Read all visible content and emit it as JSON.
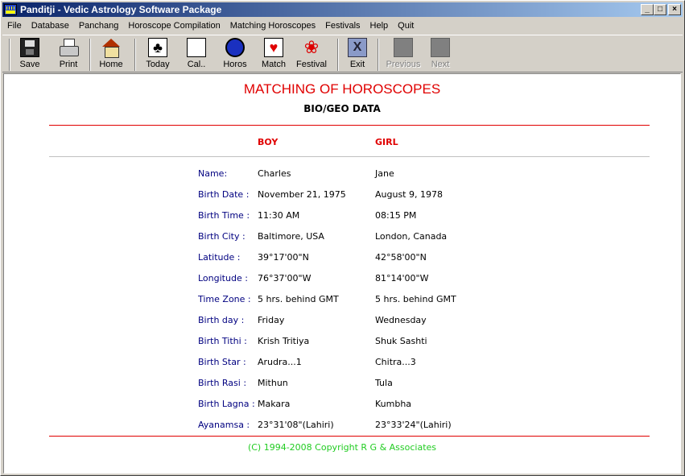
{
  "window": {
    "title": "Panditji - Vedic Astrology Software Package",
    "minimize_label": "_",
    "maximize_label": "□",
    "close_label": "×"
  },
  "menu": [
    {
      "label": "File"
    },
    {
      "label": "Database"
    },
    {
      "label": "Panchang"
    },
    {
      "label": "Horoscope Compilation"
    },
    {
      "label": "Matching Horoscopes"
    },
    {
      "label": "Festivals"
    },
    {
      "label": "Help"
    },
    {
      "label": "Quit"
    }
  ],
  "toolbar": {
    "save": "Save",
    "print": "Print",
    "home": "Home",
    "today": "Today",
    "cal": "Cal..",
    "horos": "Horos",
    "match": "Match",
    "festival": "Festival",
    "exit": "Exit",
    "previous": "Previous",
    "next": "Next",
    "today_glyph": "♣",
    "match_glyph": "♥",
    "festival_glyph": "❀",
    "exit_glyph": "X"
  },
  "report": {
    "title": "MATCHING OF HOROSCOPES",
    "subtitle": "BIO/GEO DATA",
    "boy_header": "BOY",
    "girl_header": "GIRL",
    "rows": [
      {
        "label": "Name:",
        "boy": "Charles",
        "girl": "Jane"
      },
      {
        "label": "Birth Date :",
        "boy": "November 21, 1975",
        "girl": "August 9, 1978"
      },
      {
        "label": "Birth Time :",
        "boy": "11:30 AM",
        "girl": "08:15 PM"
      },
      {
        "label": "Birth City :",
        "boy": "Baltimore,  USA",
        "girl": "London,  Canada"
      },
      {
        "label": "Latitude :",
        "boy": "39°17'00\"N",
        "girl": "42°58'00\"N"
      },
      {
        "label": "Longitude :",
        "boy": "76°37'00\"W",
        "girl": "81°14'00\"W"
      },
      {
        "label": "Time Zone :",
        "boy": "5 hrs. behind GMT",
        "girl": "5 hrs. behind GMT"
      },
      {
        "label": "Birth day :",
        "boy": "Friday",
        "girl": "Wednesday"
      },
      {
        "label": "Birth Tithi :",
        "boy": "Krish  Tritiya",
        "girl": "Shuk  Sashti"
      },
      {
        "label": "Birth Star :",
        "boy": "Arudra...1",
        "girl": "Chitra...3"
      },
      {
        "label": "Birth Rasi :",
        "boy": "Mithun",
        "girl": "Tula"
      },
      {
        "label": "Birth Lagna :",
        "boy": "Makara",
        "girl": "Kumbha"
      },
      {
        "label": "Ayanamsa :",
        "boy": "23°31'08\"(Lahiri)",
        "girl": "23°33'24\"(Lahiri)"
      }
    ],
    "copyright": "(C) 1994-2008 Copyright R G & Associates"
  }
}
